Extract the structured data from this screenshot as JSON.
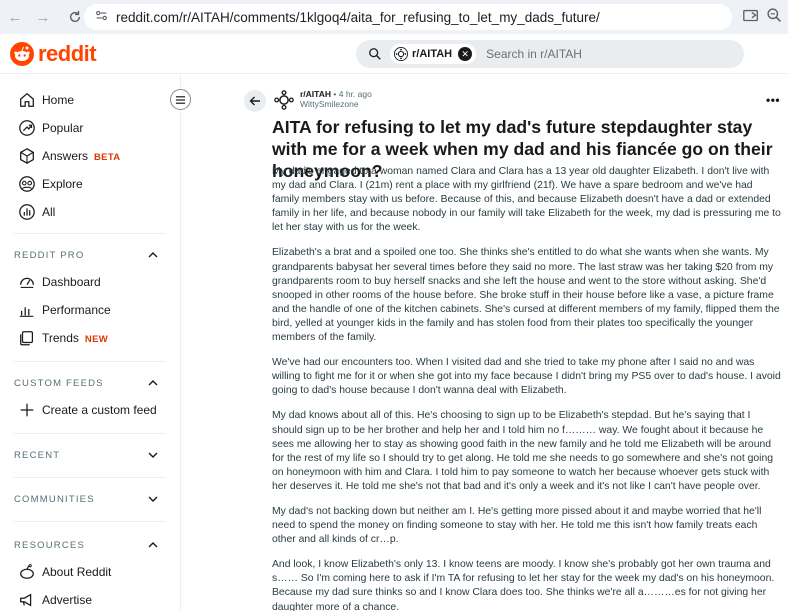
{
  "browser": {
    "url": "reddit.com/r/AITAH/comments/1klgoq4/aita_for_refusing_to_let_my_dads_future/"
  },
  "header": {
    "logo_text": "reddit",
    "search_chip": "r/AITAH",
    "search_placeholder": "Search in r/AITAH"
  },
  "sidebar": {
    "main_items": [
      {
        "label": "Home",
        "icon": "home-icon"
      },
      {
        "label": "Popular",
        "icon": "popular-icon"
      },
      {
        "label": "Answers",
        "icon": "answers-icon",
        "badge": "BETA"
      },
      {
        "label": "Explore",
        "icon": "explore-icon"
      },
      {
        "label": "All",
        "icon": "all-icon"
      }
    ],
    "reddit_pro": {
      "title": "REDDIT PRO",
      "items": [
        {
          "label": "Dashboard",
          "icon": "dashboard-icon"
        },
        {
          "label": "Performance",
          "icon": "performance-icon"
        },
        {
          "label": "Trends",
          "icon": "trends-icon",
          "badge": "NEW"
        }
      ]
    },
    "custom_feeds": {
      "title": "CUSTOM FEEDS",
      "create_label": "Create a custom feed"
    },
    "recent": {
      "title": "RECENT"
    },
    "communities": {
      "title": "COMMUNITIES"
    },
    "resources": {
      "title": "RESOURCES",
      "items": [
        {
          "label": "About Reddit",
          "icon": "about-icon"
        },
        {
          "label": "Advertise",
          "icon": "advertise-icon"
        }
      ]
    }
  },
  "post": {
    "subreddit": "r/AITAH",
    "separator": "•",
    "time": "4 hr. ago",
    "author": "WittySmilezone",
    "title": "AITA for refusing to let my dad's future stepdaughter stay with me for a week when my dad and his fiancée go on their honeymoon?",
    "paragraphs": [
      "My dad's engaged to a woman named Clara and Clara has a 13 year old daughter Elizabeth. I don't live with my dad and Clara. I (21m) rent a place with my girlfriend (21f). We have a spare bedroom and we've had family members stay with us before. Because of this, and because Elizabeth doesn't have a dad or extended family in her life, and because nobody in our family will take Elizabeth for the week, my dad is pressuring me to let her stay with us for the week.",
      "Elizabeth's a brat and a spoiled one too. She thinks she's entitled to do what she wants when she wants. My grandparents babysat her several times before they said no more. The last straw was her taking $20 from my grandparents room to buy herself snacks and she left the house and went to the store without asking. She'd snooped in other rooms of the house before. She broke stuff in their house before like a vase, a picture frame and the handle of one of the kitchen cabinets. She's cursed at different members of my family, flipped them the bird, yelled at younger kids in the family and has stolen food from their plates too specifically the younger members of the family.",
      "We've had our encounters too. When I visited dad and she tried to take my phone after I said no and was willing to fight me for it or when she got into my face because I didn't bring my PS5 over to dad's house. I avoid going to dad's house because I don't wanna deal with Elizabeth.",
      "My dad knows about all of this. He's choosing to sign up to be Elizabeth's stepdad. But he's saying that I should sign up to be her brother and help her and I told him no f……… way. We fought about it because he sees me allowing her to stay as showing good faith in the new family and he told me Elizabeth will be around for the rest of my life so I should try to get along. He told me she needs to go somewhere and she's not going on honeymoon with him and Clara. I told him to pay someone to watch her because whoever gets stuck with her deserves it. He told me she's not that bad and it's only a week and it's not like I can't have people over.",
      "My dad's not backing down but neither am I. He's getting more pissed about it and maybe worried that he'll need to spend the money on finding someone to stay with her. He told me this isn't how family treats each other and all kinds of cr…p.",
      "And look, I know Elizabeth's only 13. I know teens are moody. I know she's probably got her own trauma and s…… So I'm coming here to ask if I'm TA for refusing to let her stay for the week my dad's on his honeymoon. Because my dad sure thinks so and I know Clara does too. She thinks we're all a………es for not giving her daughter more of a chance."
    ]
  },
  "colors": {
    "brand": "#ff4500",
    "badge": "#d93a00",
    "text": "#1a1a1b",
    "muted": "#576f76"
  }
}
